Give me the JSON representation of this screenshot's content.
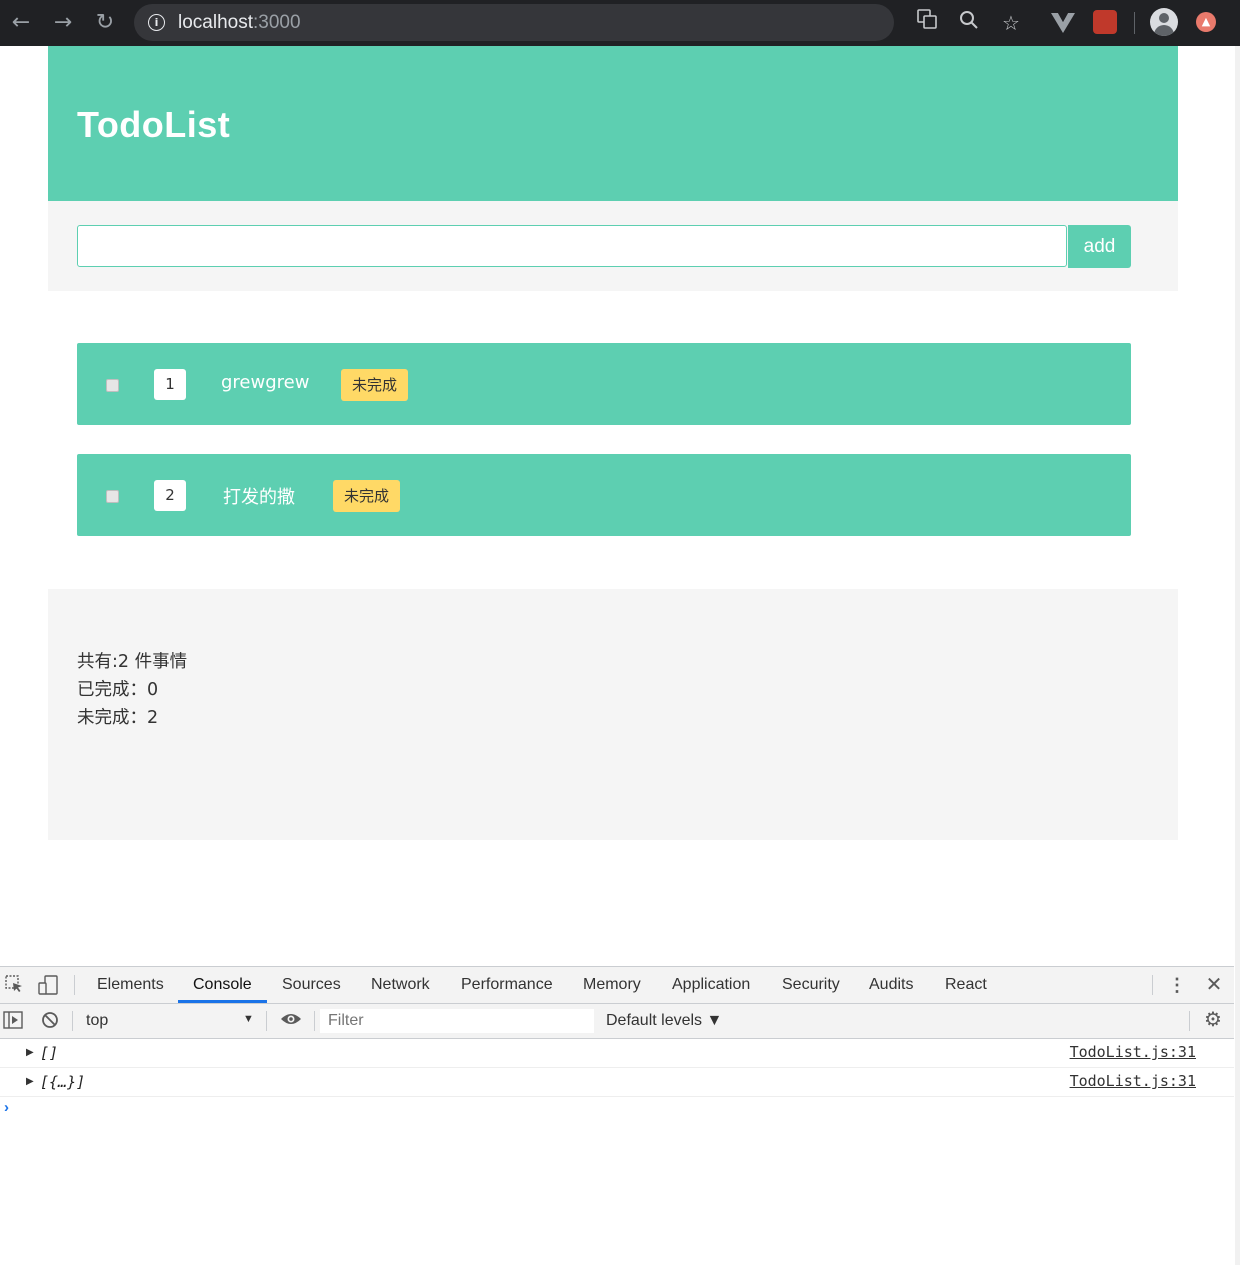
{
  "browser": {
    "url_host": "localhost",
    "url_port": ":3000"
  },
  "app": {
    "title": "TodoList",
    "input": {
      "value": "",
      "placeholder": ""
    },
    "add_label": "add",
    "todos": [
      {
        "index": "1",
        "text": "grewgrew",
        "status": "未完成",
        "checked": false
      },
      {
        "index": "2",
        "text": "打发的撒",
        "status": "未完成",
        "checked": false
      }
    ],
    "stats": {
      "total": "共有:2 件事情",
      "done": "已完成：0",
      "undone": "未完成：2"
    },
    "colors": {
      "accent": "#5dcfb1",
      "status_badge": "#ffd966",
      "panel": "#f5f5f5"
    }
  },
  "devtools": {
    "tabs": [
      "Elements",
      "Console",
      "Sources",
      "Network",
      "Performance",
      "Memory",
      "Application",
      "Security",
      "Audits",
      "React"
    ],
    "active_tab": "Console",
    "context": "top",
    "filter_placeholder": "Filter",
    "levels_label": "Default levels ▼",
    "logs": [
      {
        "text": "[]",
        "source": "TodoList.js:31"
      },
      {
        "text": "[{…}]",
        "source": "TodoList.js:31"
      }
    ],
    "prompt": "›"
  }
}
